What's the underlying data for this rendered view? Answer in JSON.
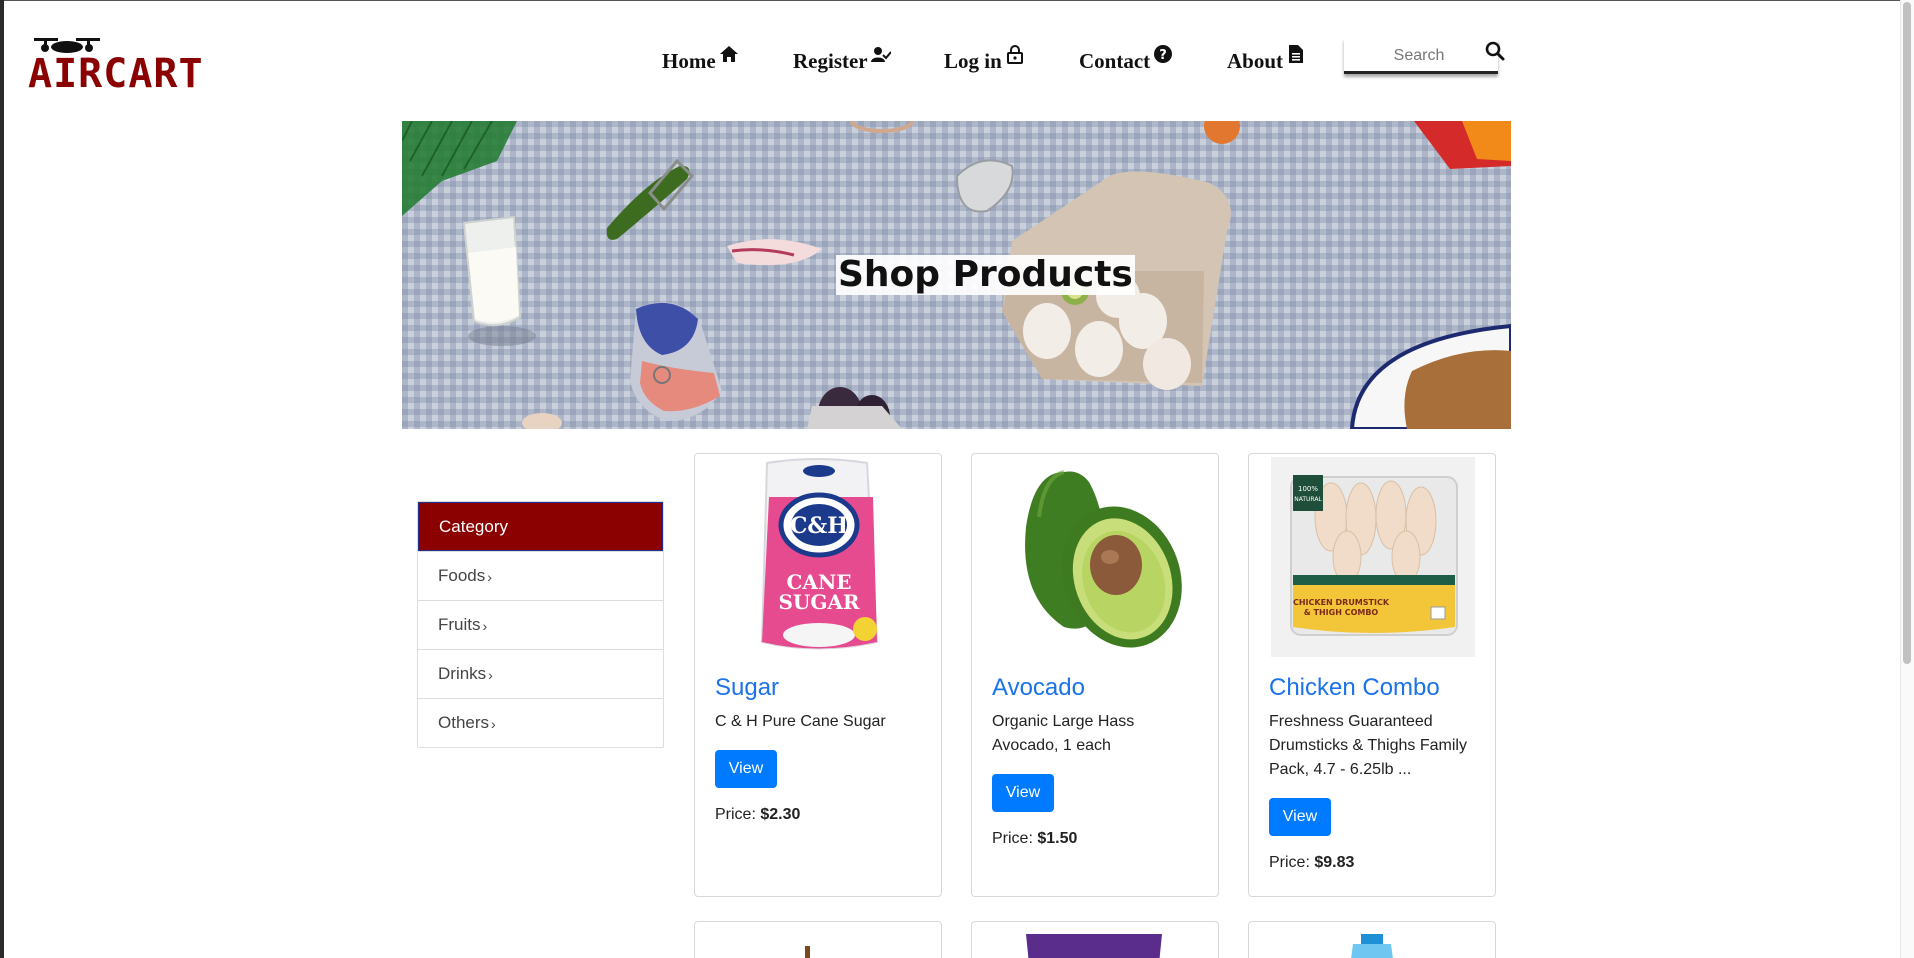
{
  "brand": {
    "name": "AIRCART",
    "color": "#8b0000"
  },
  "nav": {
    "items": [
      {
        "label": "Home",
        "icon": "home-icon"
      },
      {
        "label": "Register",
        "icon": "user-check-icon"
      },
      {
        "label": "Log in",
        "icon": "lock-icon"
      },
      {
        "label": "Contact",
        "icon": "question-circle-icon"
      },
      {
        "label": "About",
        "icon": "document-icon"
      }
    ],
    "search": {
      "placeholder": "Search",
      "value": ""
    }
  },
  "banner": {
    "title": "Shop Products"
  },
  "category": {
    "header": "Category",
    "items": [
      {
        "label": "Foods"
      },
      {
        "label": "Fruits"
      },
      {
        "label": "Drinks"
      },
      {
        "label": "Others"
      }
    ]
  },
  "products": [
    {
      "name": "Sugar",
      "description": "C & H Pure Cane Sugar",
      "button": "View",
      "price_label": "Price:",
      "price": "$2.30"
    },
    {
      "name": "Avocado",
      "description": "Organic Large Hass Avocado, 1 each",
      "button": "View",
      "price_label": "Price:",
      "price": "$1.50"
    },
    {
      "name": "Chicken Combo",
      "description": "Freshness Guaranteed Drumsticks & Thighs Family Pack, 4.7 - 6.25lb ...",
      "button": "View",
      "price_label": "Price:",
      "price": "$9.83"
    }
  ],
  "colors": {
    "accent": "#007bff",
    "link": "#1a73e8",
    "category_header": "#8b0000"
  }
}
